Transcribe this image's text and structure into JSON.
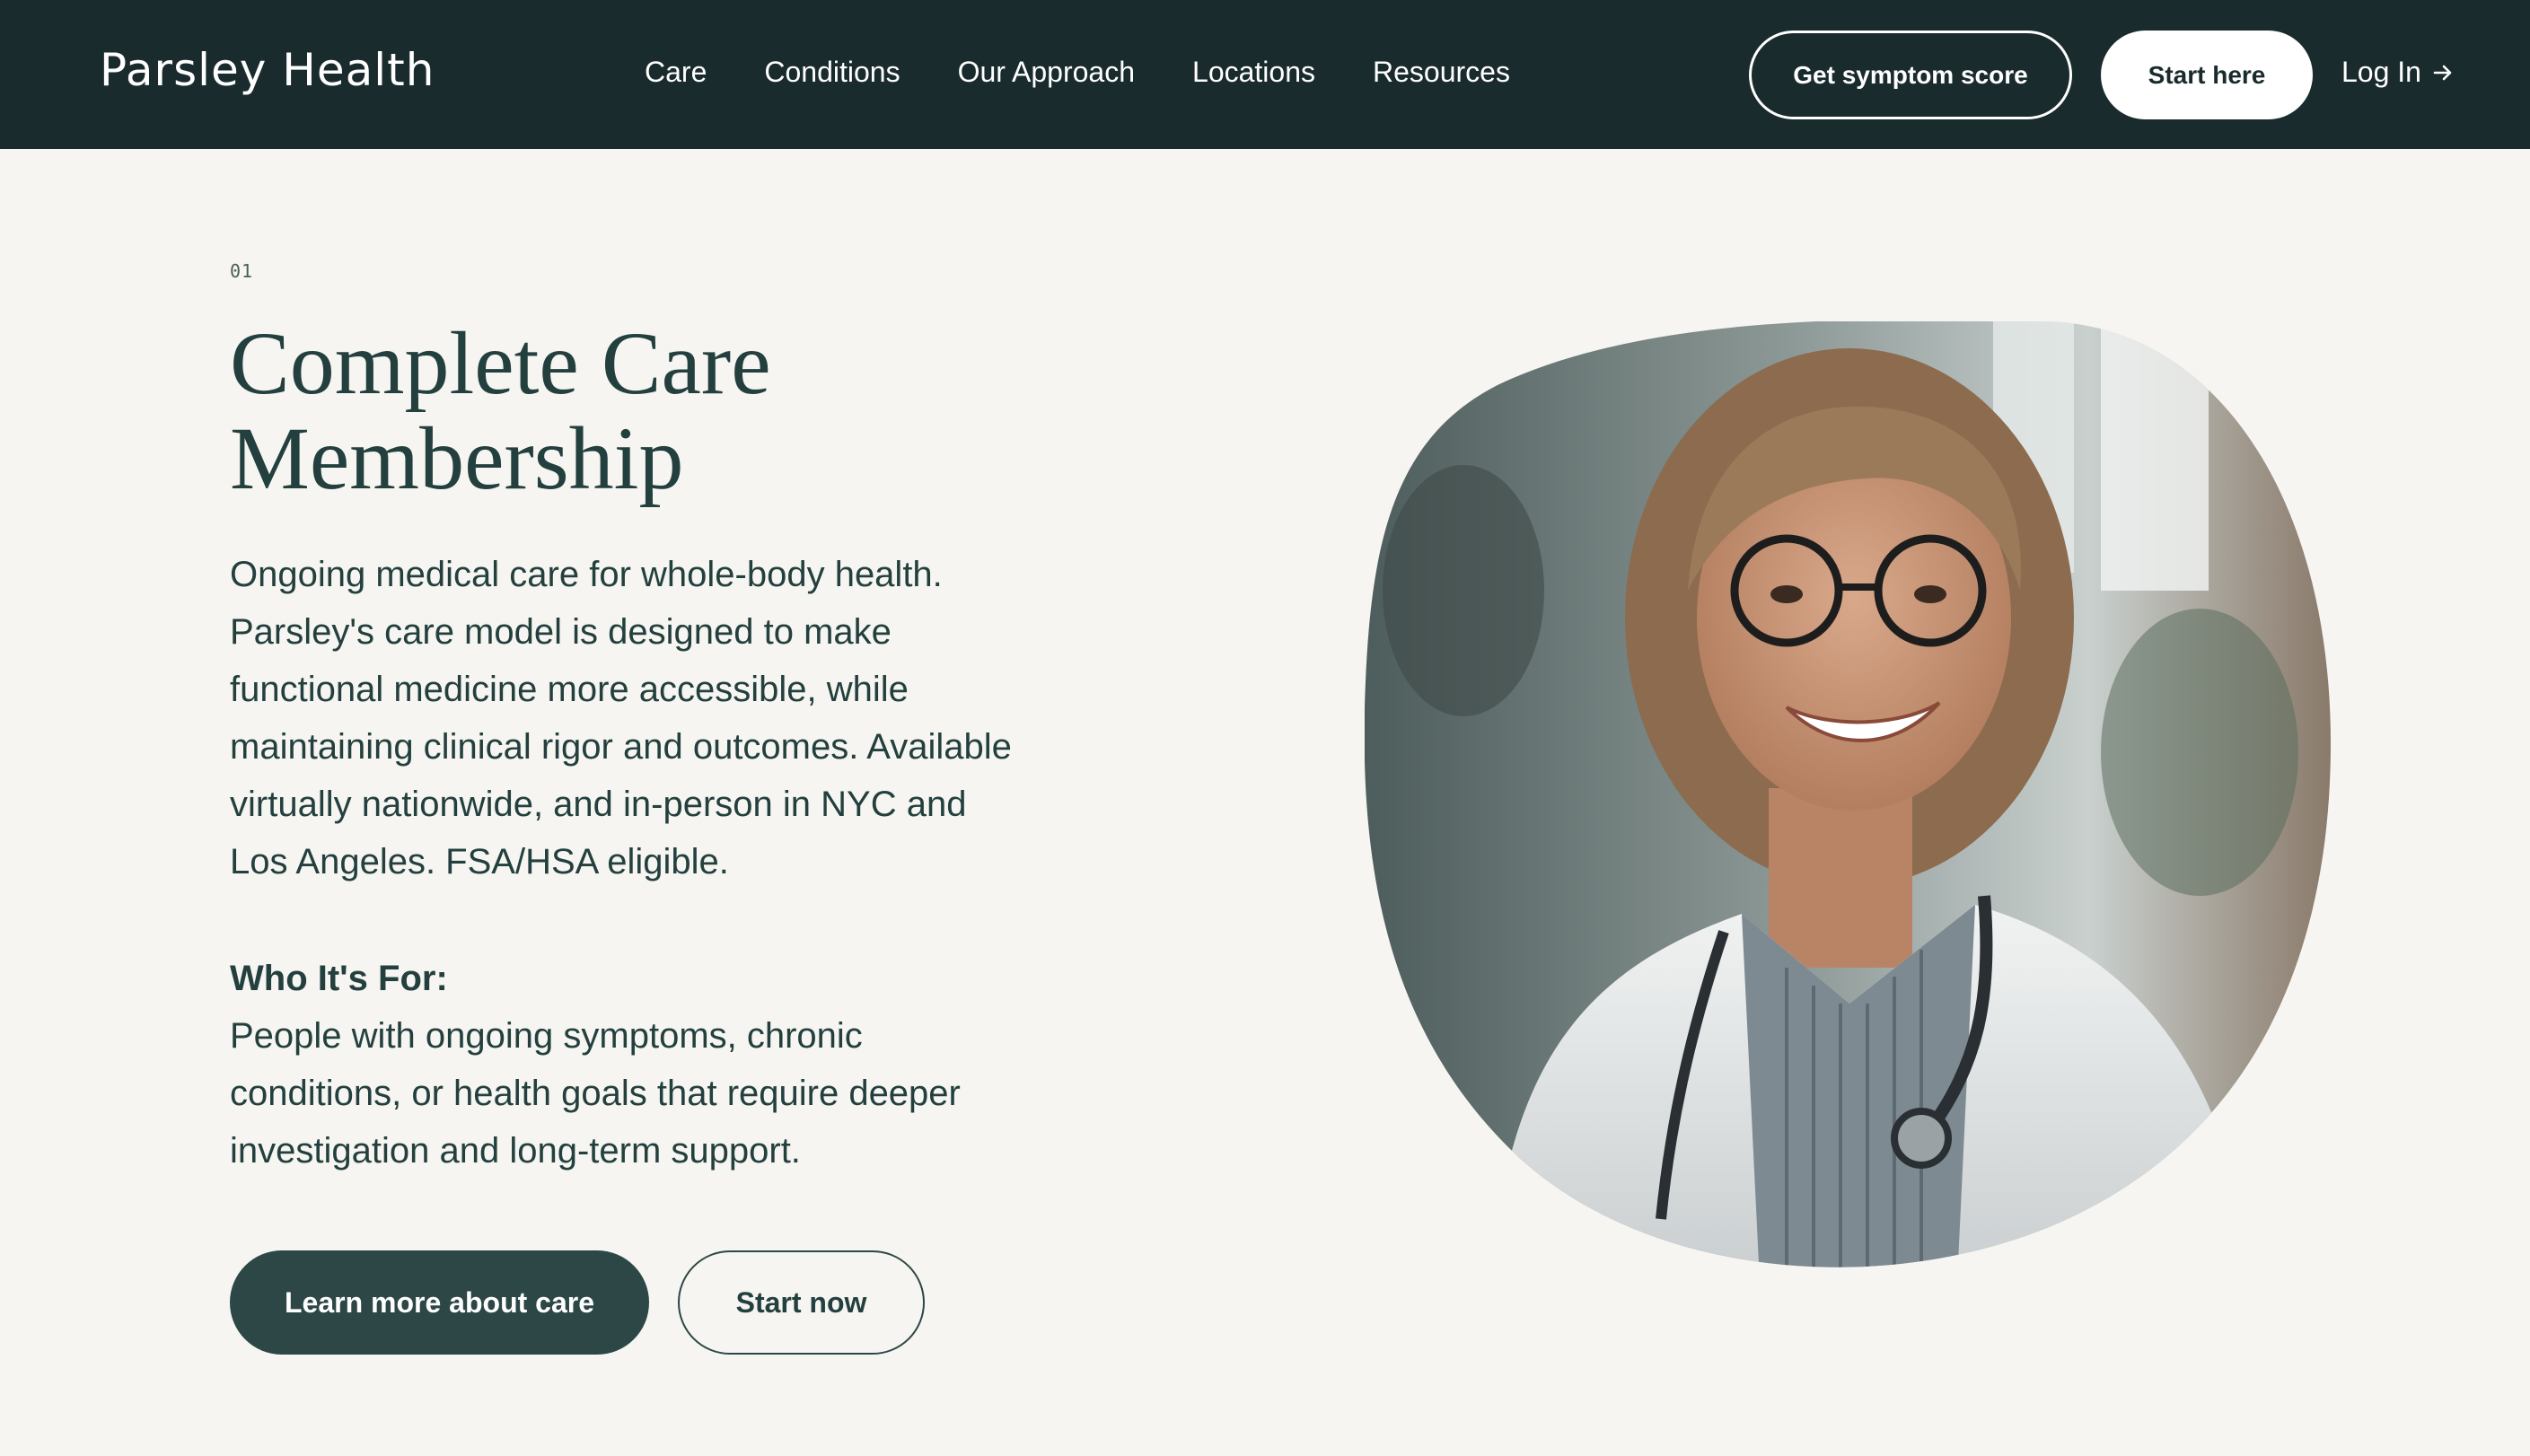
{
  "header": {
    "logo": "Parsley Health",
    "nav": [
      "Care",
      "Conditions",
      "Our Approach",
      "Locations",
      "Resources"
    ],
    "symptom_button": "Get symptom score",
    "start_here_button": "Start here",
    "login": "Log In"
  },
  "main": {
    "eyebrow": "01",
    "title_line1": "Complete Care",
    "title_line2": "Membership",
    "description": "Ongoing medical care for whole-body health. Parsley's care model is designed to make functional medicine more accessible, while maintaining clinical rigor and outcomes. Available virtually nationwide, and in-person in NYC and Los Angeles. FSA/HSA eligible.",
    "who_label": "Who It's For:",
    "who_text": "People with ongoing symptoms, chronic conditions, or health goals that require deeper investigation and long-term support.",
    "learn_button": "Learn more about care",
    "start_now_button": "Start now"
  },
  "colors": {
    "header_bg": "#1a2b2d",
    "page_bg": "#f6f5f1",
    "text": "#23403e",
    "primary_button": "#2c4746"
  },
  "icons": {
    "login_arrow": "arrow-right-icon"
  }
}
